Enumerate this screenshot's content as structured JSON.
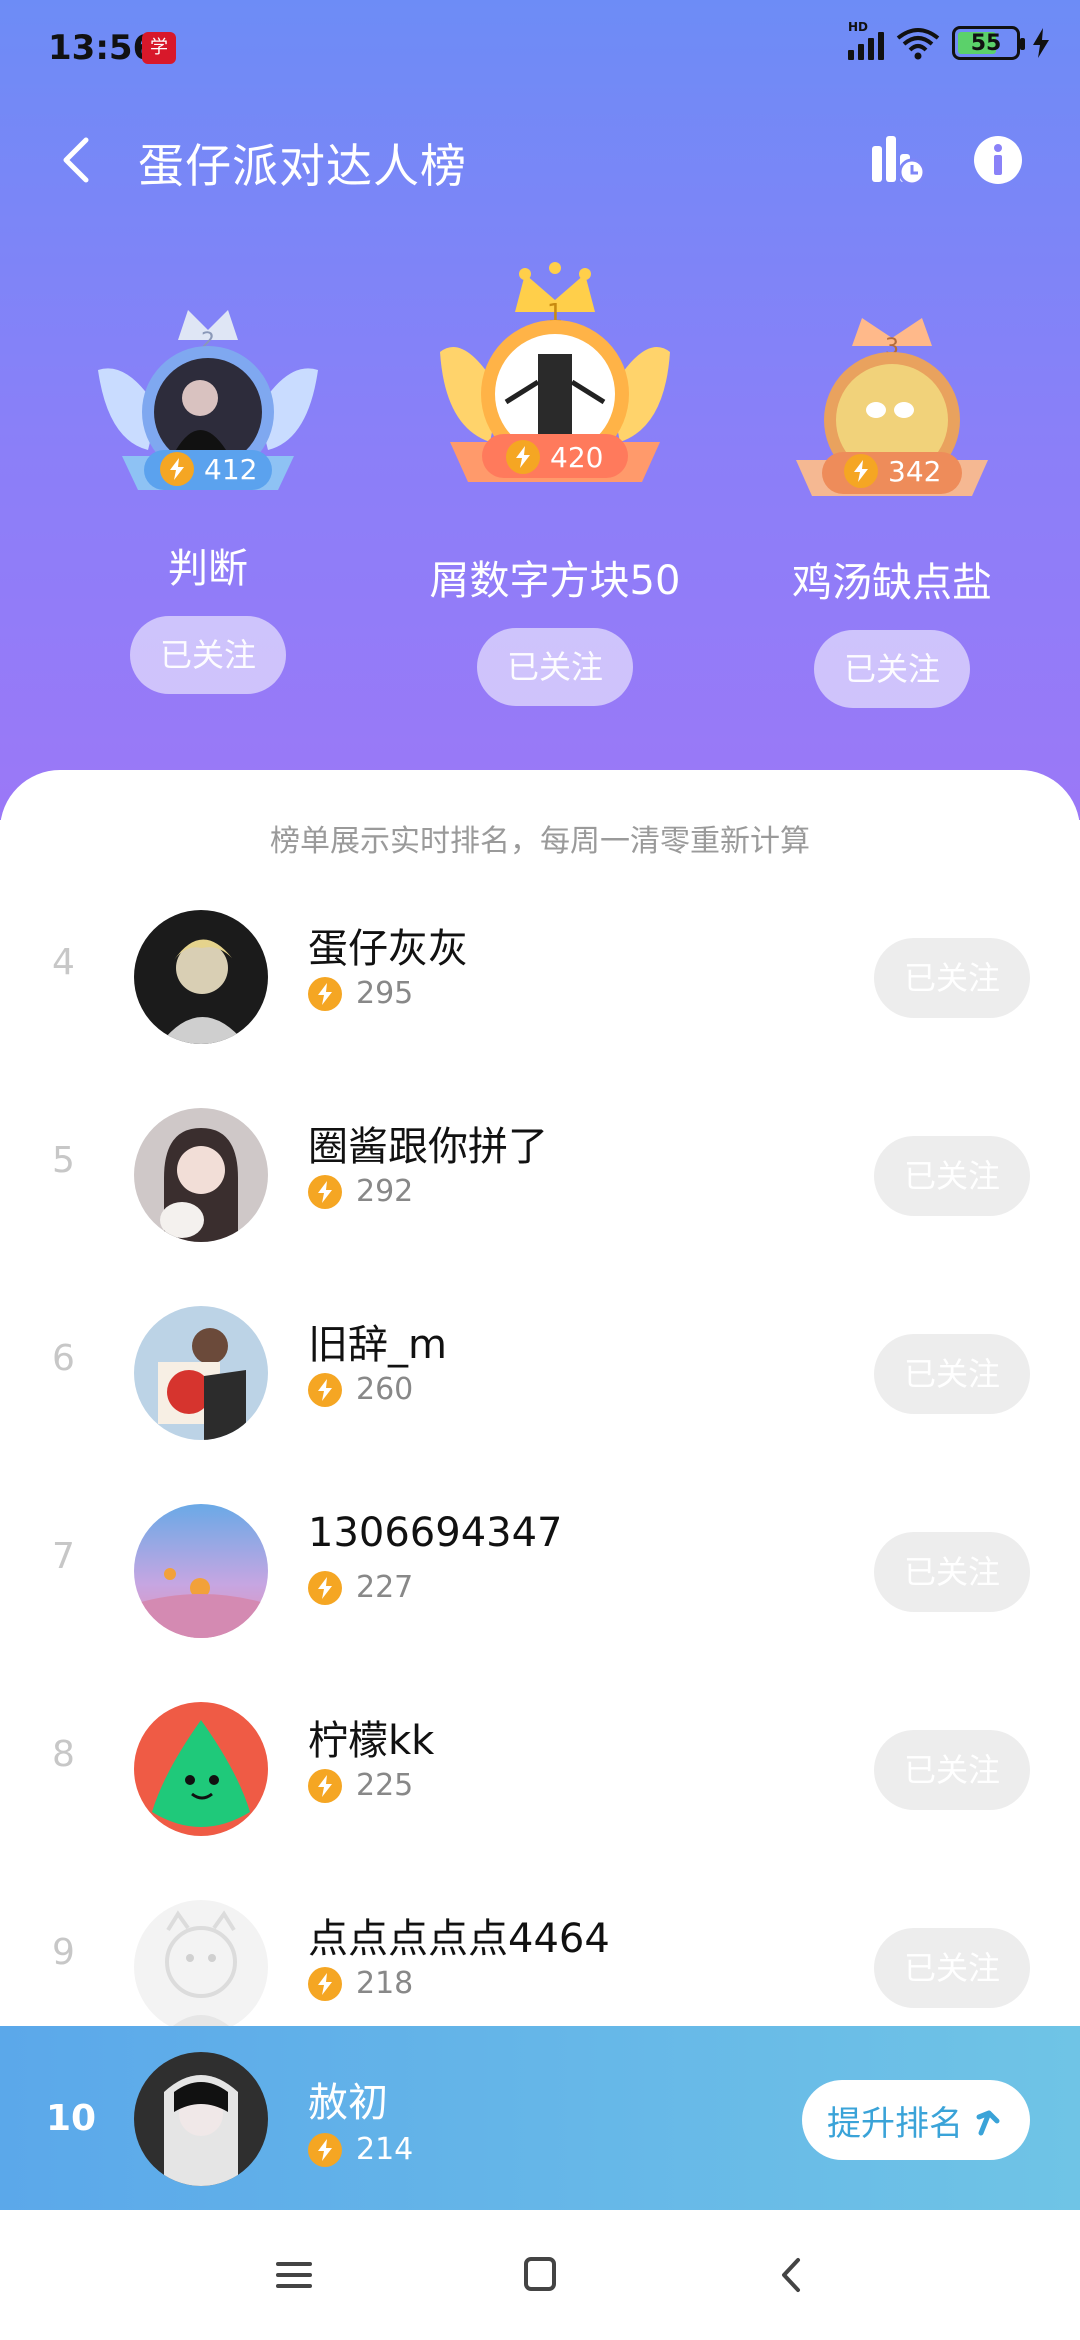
{
  "status": {
    "time": "13:56",
    "hd": "HD",
    "battery": "55"
  },
  "header": {
    "title": "蛋仔派对达人榜"
  },
  "podium": [
    {
      "rank": "2",
      "name": "判断",
      "score": "412",
      "follow_label": "已关注"
    },
    {
      "rank": "1",
      "name": "屑数字方块50",
      "score": "420",
      "follow_label": "已关注"
    },
    {
      "rank": "3",
      "name": "鸡汤缺点盐",
      "score": "342",
      "follow_label": "已关注"
    }
  ],
  "notice": "榜单展示实时排名，每周一清零重新计算",
  "list": [
    {
      "rank": "4",
      "name": "蛋仔灰灰",
      "score": "295",
      "follow_label": "已关注"
    },
    {
      "rank": "5",
      "name": "圈酱跟你拼了",
      "score": "292",
      "follow_label": "已关注"
    },
    {
      "rank": "6",
      "name": "旧辞_m",
      "score": "260",
      "follow_label": "已关注"
    },
    {
      "rank": "7",
      "name": "1306694347",
      "score": "227",
      "follow_label": "已关注"
    },
    {
      "rank": "8",
      "name": "柠檬kk",
      "score": "225",
      "follow_label": "已关注"
    },
    {
      "rank": "9",
      "name": "点点点点点4464",
      "score": "218",
      "follow_label": "已关注"
    }
  ],
  "me": {
    "rank": "10",
    "name": "赦初",
    "score": "214",
    "boost_label": "提升排名"
  },
  "colors": {
    "hero_top": "#6d8cf6",
    "hero_bottom": "#9b78f7",
    "bolt": "#f5a623",
    "me_bar": "#5ba8ea"
  }
}
